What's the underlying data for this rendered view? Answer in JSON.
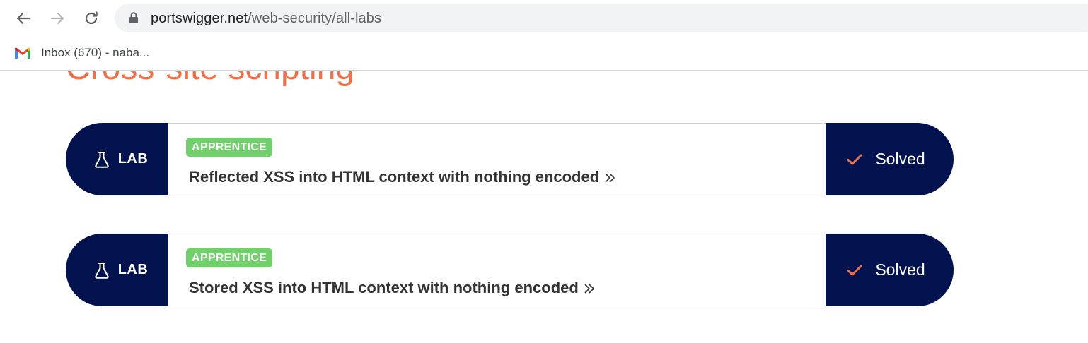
{
  "browser": {
    "url_host": "portswigger.net",
    "url_path": "/web-security/all-labs",
    "bookmarks": [
      {
        "label": "Inbox (670) - naba...",
        "icon": "gmail-icon"
      }
    ]
  },
  "page": {
    "section_title": "Cross-site scripting",
    "accent_color": "#f0704a",
    "navy_color": "#02124e",
    "badge_color": "#70d16a",
    "labs": [
      {
        "tag": "LAB",
        "level": "APPRENTICE",
        "title": "Reflected XSS into HTML context with nothing encoded",
        "status": "Solved"
      },
      {
        "tag": "LAB",
        "level": "APPRENTICE",
        "title": "Stored XSS into HTML context with nothing encoded",
        "status": "Solved"
      }
    ]
  }
}
